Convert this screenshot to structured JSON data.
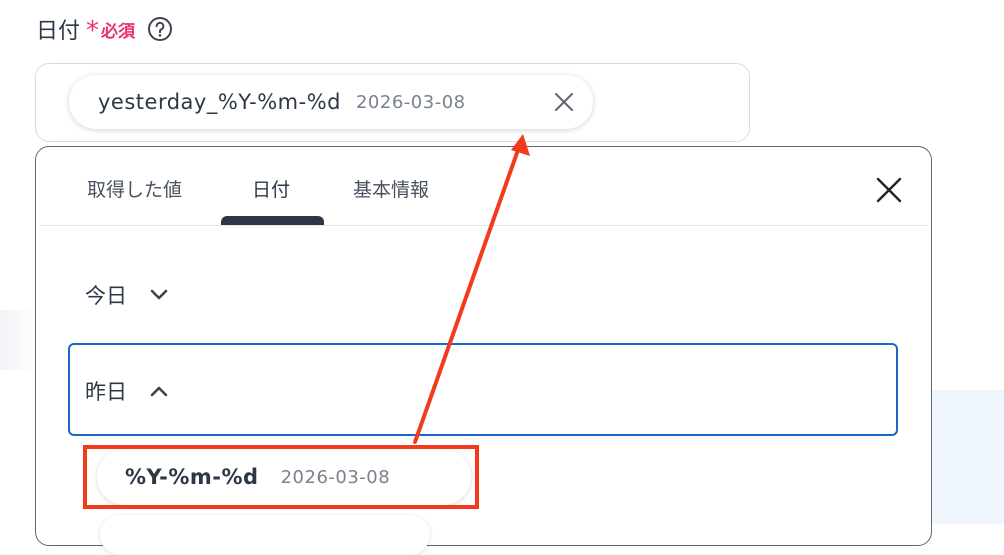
{
  "field": {
    "label": "日付",
    "required_star": "*",
    "required_text": "必須",
    "help_icon": "question-circle-icon"
  },
  "selected_chip": {
    "key": "yesterday_%Y-%m-%d",
    "value": "2026-03-08",
    "remove_icon": "close-icon"
  },
  "dropdown": {
    "tabs": [
      {
        "label": "取得した値",
        "active": false
      },
      {
        "label": "日付",
        "active": true
      },
      {
        "label": "基本情報",
        "active": false
      }
    ],
    "close_icon": "close-icon",
    "sections": [
      {
        "label": "今日",
        "expanded": false,
        "icon": "chevron-down-icon"
      },
      {
        "label": "昨日",
        "expanded": true,
        "icon": "chevron-up-icon"
      }
    ],
    "options": [
      {
        "key": "%Y-%m-%d",
        "value": "2026-03-08"
      }
    ]
  },
  "colors": {
    "required": "#e8336b",
    "focus_border": "#1a66c9",
    "annotation": "#f23a1d",
    "text": "#2d3748",
    "muted": "#7a8290"
  }
}
